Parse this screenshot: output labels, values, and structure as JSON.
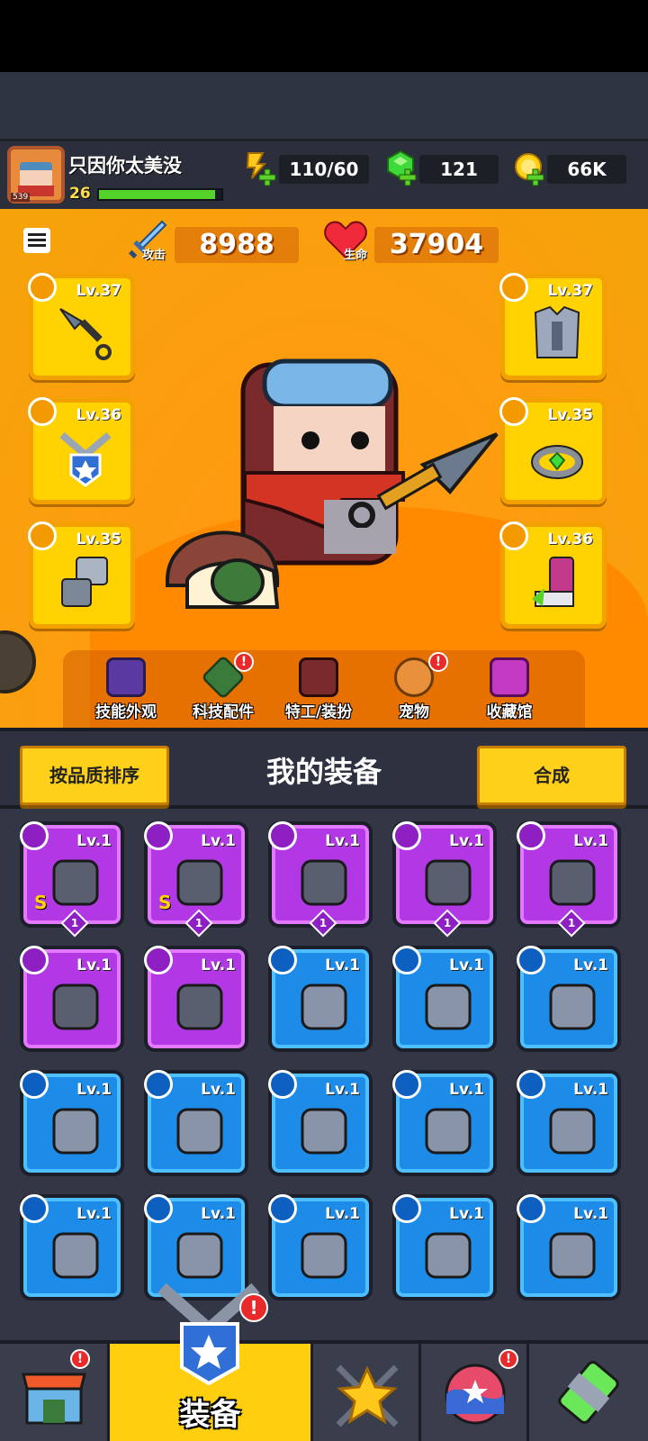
{
  "player": {
    "name": "只因你太美没",
    "level": "26",
    "avatar_id": "539",
    "xp_fraction": 0.95
  },
  "resources": {
    "stamina": "110/60",
    "gems": "121",
    "gold": "66K"
  },
  "stats": {
    "attack_label": "攻击",
    "attack_value": "8988",
    "hp_label": "生命",
    "hp_value": "37904"
  },
  "equipped": {
    "left": [
      {
        "level": "Lv.37",
        "type": "weapon",
        "icon": "kunai-icon"
      },
      {
        "level": "Lv.36",
        "type": "necklace",
        "icon": "necklace-icon"
      },
      {
        "level": "Lv.35",
        "type": "gloves",
        "icon": "gauntlet-icon"
      }
    ],
    "right": [
      {
        "level": "Lv.37",
        "type": "armor",
        "icon": "armor-icon"
      },
      {
        "level": "Lv.35",
        "type": "ring",
        "icon": "ring-icon"
      },
      {
        "level": "Lv.36",
        "type": "boots",
        "icon": "boots-icon"
      }
    ]
  },
  "hero_nav": [
    {
      "label": "技能外观",
      "alert": false
    },
    {
      "label": "科技配件",
      "alert": true
    },
    {
      "label": "特工/装扮",
      "alert": false
    },
    {
      "label": "宠物",
      "alert": true
    },
    {
      "label": "收藏馆",
      "alert": false
    }
  ],
  "inventory": {
    "sort_label": "按品质排序",
    "title": "我的装备",
    "merge_label": "合成",
    "items": [
      {
        "level": "Lv.1",
        "rarity": "purple",
        "type": "armor",
        "icon": "dark-armor-icon",
        "s_rank": "S",
        "count": "1"
      },
      {
        "level": "Lv.1",
        "rarity": "purple",
        "type": "armor",
        "icon": "dark-armor-icon",
        "s_rank": "S",
        "count": "1"
      },
      {
        "level": "Lv.1",
        "rarity": "purple",
        "type": "weapon",
        "icon": "kunai-icon",
        "s_rank": "",
        "count": "1"
      },
      {
        "level": "Lv.1",
        "rarity": "purple",
        "type": "weapon",
        "icon": "kunai-icon",
        "s_rank": "",
        "count": "1"
      },
      {
        "level": "Lv.1",
        "rarity": "purple",
        "type": "boots",
        "icon": "tech-boots-icon",
        "s_rank": "",
        "count": "1"
      },
      {
        "level": "Lv.1",
        "rarity": "purple",
        "type": "necklace",
        "icon": "spiked-collar-icon",
        "s_rank": "",
        "count": ""
      },
      {
        "level": "Lv.1",
        "rarity": "purple",
        "type": "gloves",
        "icon": "gauntlet-icon",
        "s_rank": "",
        "count": ""
      },
      {
        "level": "Lv.1",
        "rarity": "blue",
        "type": "weapon",
        "icon": "kunai-icon",
        "s_rank": "",
        "count": ""
      },
      {
        "level": "Lv.1",
        "rarity": "blue",
        "type": "weapon",
        "icon": "machete-icon",
        "s_rank": "",
        "count": ""
      },
      {
        "level": "Lv.1",
        "rarity": "blue",
        "type": "weapon",
        "icon": "machete-icon",
        "s_rank": "",
        "count": ""
      },
      {
        "level": "Lv.1",
        "rarity": "blue",
        "type": "weapon",
        "icon": "revolver-icon",
        "s_rank": "",
        "count": ""
      },
      {
        "level": "Lv.1",
        "rarity": "blue",
        "type": "weapon",
        "icon": "revolver-icon",
        "s_rank": "",
        "count": ""
      },
      {
        "level": "Lv.1",
        "rarity": "blue",
        "type": "weapon",
        "icon": "bat-icon",
        "s_rank": "",
        "count": ""
      },
      {
        "level": "Lv.1",
        "rarity": "blue",
        "type": "weapon",
        "icon": "bat-icon",
        "s_rank": "",
        "count": ""
      },
      {
        "level": "Lv.1",
        "rarity": "blue",
        "type": "armor",
        "icon": "jacket-icon",
        "s_rank": "",
        "count": ""
      },
      {
        "level": "Lv.1",
        "rarity": "blue",
        "type": "armor",
        "icon": "vest-icon",
        "s_rank": "",
        "count": ""
      },
      {
        "level": "Lv.1",
        "rarity": "blue",
        "type": "armor",
        "icon": "blue-vest-icon",
        "s_rank": "",
        "count": ""
      },
      {
        "level": "Lv.1",
        "rarity": "blue",
        "type": "armor",
        "icon": "shirt-icon",
        "s_rank": "",
        "count": ""
      },
      {
        "level": "Lv.1",
        "rarity": "blue",
        "type": "necklace",
        "icon": "bone-necklace-icon",
        "s_rank": "",
        "count": ""
      },
      {
        "level": "Lv.1",
        "rarity": "blue",
        "type": "necklace",
        "icon": "gem-necklace-icon",
        "s_rank": "",
        "count": ""
      }
    ]
  },
  "tabbar": {
    "active_label": "装备",
    "tabs": [
      {
        "name": "shop",
        "alert": true
      },
      {
        "name": "equipment",
        "alert": true
      },
      {
        "name": "battle",
        "alert": false
      },
      {
        "name": "events",
        "alert": true
      },
      {
        "name": "evolution",
        "alert": false
      }
    ]
  },
  "colors": {
    "hero_bg": "#ff9b10",
    "slot_gold": "#ffd200",
    "rarity_purple": "#b238e6",
    "rarity_blue": "#1d8be8",
    "button_yellow": "#ffd01a",
    "alert_red": "#e82a2a"
  }
}
